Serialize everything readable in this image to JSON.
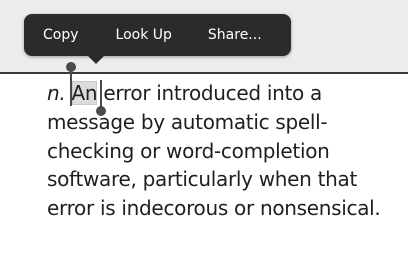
{
  "edit_menu": {
    "items": [
      {
        "label": "Copy"
      },
      {
        "label": "Look Up"
      },
      {
        "label": "Share..."
      }
    ]
  },
  "definition": {
    "part_of_speech": "n.",
    "selected_word": "An",
    "text_after_selection": "error introduced into a message by automatic spell-checking or word-completion software, particularly when that error is indecorous or nonsensical."
  },
  "colors": {
    "menu_background": "#2b2b2b",
    "menu_text": "#ffffff",
    "top_bar": "#ececec",
    "selection_highlight": "#dcdcdc",
    "body_text": "#1f1f1f"
  }
}
